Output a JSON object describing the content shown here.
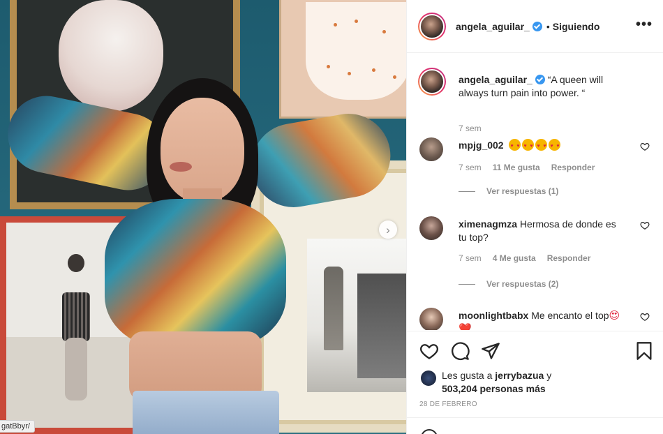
{
  "post": {
    "username": "angela_aguilar_",
    "separator": "•",
    "follow_status": "Siguiendo",
    "more_label": "•••",
    "caption": "“A queen will always turn pain into power. “",
    "caption_time": "7 sem"
  },
  "photo": {
    "next_label": "›",
    "link_hint": "gatBbyr/"
  },
  "comments": [
    {
      "username": "mpjg_002",
      "emoji_count": 4,
      "time": "7 sem",
      "likes": "11 Me gusta",
      "reply_label": "Responder",
      "view_replies": "Ver respuestas (1)"
    },
    {
      "username": "ximenagmza",
      "text": "Hermosa de donde es tu top?",
      "time": "7 sem",
      "likes": "4 Me gusta",
      "reply_label": "Responder",
      "view_replies": "Ver respuestas (2)"
    },
    {
      "username": "moonlightbabx",
      "text": "Me encanto el top",
      "emoji": "😍❤️"
    }
  ],
  "likes": {
    "prefix": "Les gusta a",
    "user": "jerrybazua",
    "connector": "y",
    "others": "503,204 personas más"
  },
  "date": "28 DE FEBRERO",
  "icons": {
    "like": "heart-outline-icon",
    "comment": "comment-bubble-icon",
    "share": "paper-plane-icon",
    "save": "bookmark-icon",
    "verified": "verified-badge-icon"
  },
  "colors": {
    "verified": "#3897f0",
    "text": "#262626",
    "muted": "#8e8e8e"
  }
}
